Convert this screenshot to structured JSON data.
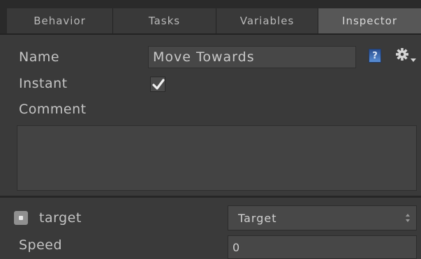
{
  "tabs": [
    {
      "label": "Behavior"
    },
    {
      "label": "Tasks"
    },
    {
      "label": "Variables"
    },
    {
      "label": "Inspector",
      "active": true
    }
  ],
  "inspector": {
    "name_label": "Name",
    "name_value": "Move Towards",
    "instant_label": "Instant",
    "instant_checked": true,
    "comment_label": "Comment",
    "comment_value": "",
    "help_icon": "help-book-icon",
    "settings_icon": "gear-dropdown-icon"
  },
  "variables": [
    {
      "name": "target",
      "icon": "shared-variable-icon",
      "type": "dropdown",
      "value": "Target"
    },
    {
      "name": "Speed",
      "type": "number",
      "value": "0"
    }
  ],
  "colors": {
    "active_tab": "#575757",
    "background": "#3a3a3a",
    "help_icon": "#3b6cb8"
  }
}
